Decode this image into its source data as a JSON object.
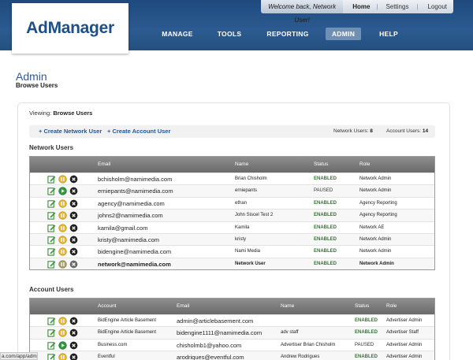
{
  "brand": {
    "logo_text": "AdManager"
  },
  "topbar": {
    "welcome": "Welcome back, Network User!",
    "home": "Home",
    "settings": "Settings",
    "logout": "Logout",
    "sep": "|"
  },
  "nav": {
    "manage": "MANAGE",
    "tools": "TOOLS",
    "reporting": "REPORTING",
    "admin": "ADMIN",
    "help": "HELP"
  },
  "page": {
    "title": "Admin",
    "subtitle": "Browse Users"
  },
  "viewing": {
    "label": "Viewing:",
    "value": "Browse Users"
  },
  "actions": {
    "create_network": "+ Create Network User",
    "create_account": "+ Create Account User",
    "network_users_label": "Network Users:",
    "network_users_count": "8",
    "account_users_label": "Account Users:",
    "account_users_count": "14"
  },
  "network_users": {
    "section_title": "Network Users",
    "headers": {
      "email": "Email",
      "name": "Name",
      "status": "Status",
      "role": "Role"
    },
    "rows": [
      {
        "email": "bchisholm@namimedia.com",
        "name": "Brian Chisholm",
        "status": "ENABLED",
        "role": "Network Admin"
      },
      {
        "email": "erniepants@namimedia.com",
        "name": "erniepants",
        "status": "PAUSED",
        "role": "Network Admin"
      },
      {
        "email": "agency@namimedia.com",
        "name": "ethan",
        "status": "ENABLED",
        "role": "Agency Reporting"
      },
      {
        "email": "johns2@namimedia.com",
        "name": "John Siscel Test 2",
        "status": "ENABLED",
        "role": "Agency Reporting"
      },
      {
        "email": "kamila@gmail.com",
        "name": "Kamila",
        "status": "ENABLED",
        "role": "Network AE"
      },
      {
        "email": "kristy@namimedia.com",
        "name": "kristy",
        "status": "ENABLED",
        "role": "Network Admin"
      },
      {
        "email": "bidengine@namimedia.com",
        "name": "Nami Media",
        "status": "ENABLED",
        "role": "Network Admin"
      },
      {
        "email": "network@namimedia.com",
        "name": "Network User",
        "status": "ENABLED",
        "role": "Network Admin"
      }
    ]
  },
  "account_users": {
    "section_title": "Account Users",
    "headers": {
      "account": "Account",
      "email": "Email",
      "name": "Name",
      "status": "Status",
      "role": "Role"
    },
    "rows": [
      {
        "account": "BidEngine Article Basement",
        "email": "admin@articlebasement.com",
        "name": "",
        "status": "ENABLED",
        "role": "Advertiser Admin"
      },
      {
        "account": "BidEngine Article Basement",
        "email": "bidengine1111@namimedia.com",
        "name": "adv staff",
        "status": "ENABLED",
        "role": "Advertiser Staff"
      },
      {
        "account": "Business.com",
        "email": "chisholmb1@yahoo.com",
        "name": "Advertiser Brian Chisholm",
        "status": "PAUSED",
        "role": "Advertiser Admin"
      },
      {
        "account": "Eventful",
        "email": "arodriques@eventful.com",
        "name": "Andrew Rodrigues",
        "status": "ENABLED",
        "role": "Advertiser Admin"
      }
    ]
  },
  "statusbar": {
    "url": "a.com/app/admin"
  },
  "colors": {
    "header_blue": "#24507f",
    "brand_blue": "#1e4f86",
    "enabled_green": "#2c7a2c",
    "link_blue": "#1e5799"
  }
}
